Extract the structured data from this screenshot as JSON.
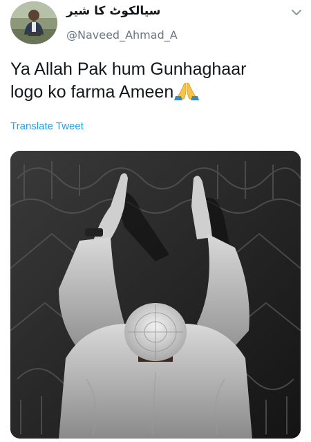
{
  "tweet": {
    "display_name": "سیالکوٹ کا شیر",
    "handle": "@Naveed_Ahmad_A",
    "text": "Ya Allah Pak hum Gunhaghaar logo ko farma Ameen",
    "emoji": "folded-hands-emoji",
    "translate_label": "Translate Tweet"
  },
  "icons": {
    "menu": "chevron-down-icon"
  },
  "colors": {
    "link": "#1da1f2",
    "handle": "#657786",
    "text": "#14171a"
  }
}
